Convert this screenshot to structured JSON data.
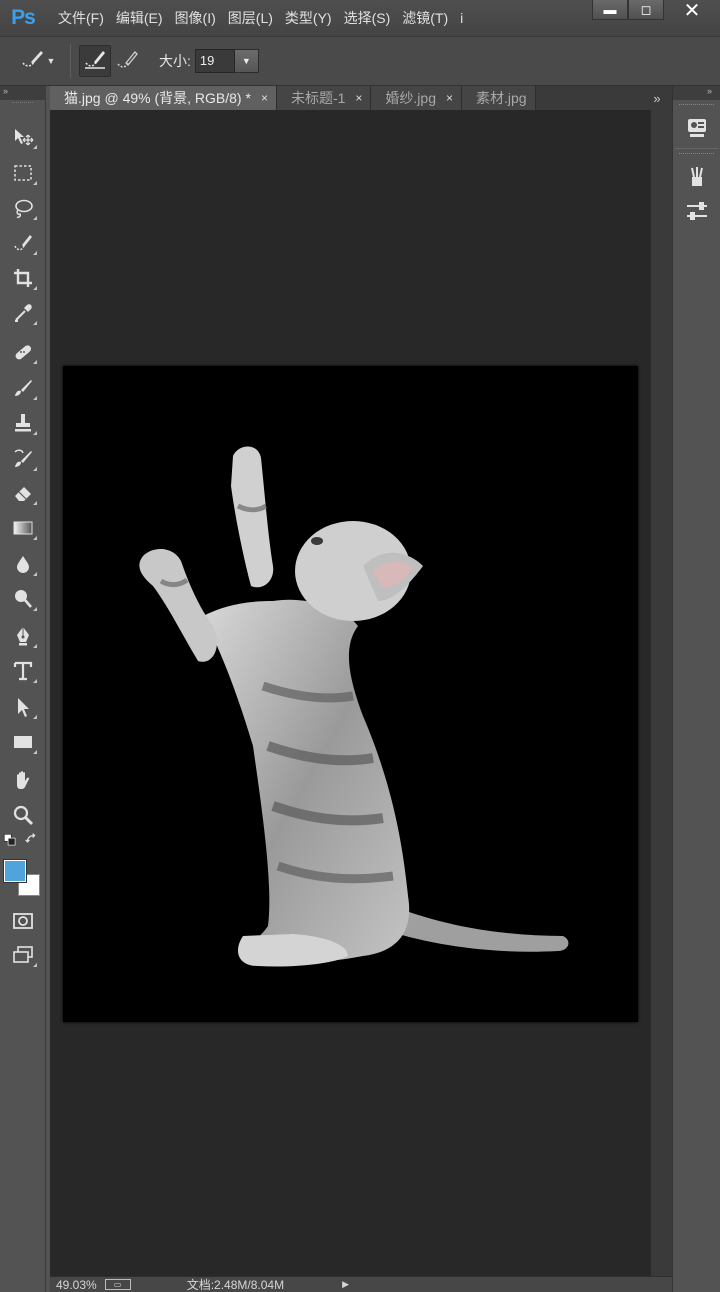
{
  "app": {
    "logo": "Ps"
  },
  "menu": {
    "items": [
      "文件(F)",
      "编辑(E)",
      "图像(I)",
      "图层(L)",
      "类型(Y)",
      "选择(S)",
      "滤镜(T)",
      "i"
    ]
  },
  "window_controls": {
    "minimize": "▬",
    "restore": "◻",
    "close": "✕"
  },
  "options": {
    "size_label": "大小:",
    "size_value": "19",
    "tool_icon": "quick-selection-icon",
    "mode_icons": [
      "new-selection-brush-icon",
      "subtract-brush-icon"
    ]
  },
  "tabs": [
    {
      "label": "猫.jpg @ 49% (背景, RGB/8) *",
      "active": true
    },
    {
      "label": "未标题-1",
      "active": false
    },
    {
      "label": "婚纱.jpg",
      "active": false
    },
    {
      "label": "素材.jpg",
      "active": false
    }
  ],
  "tab_close_glyph": "×",
  "tab_more_glyph": "»",
  "panel_collapse_glyph": "»",
  "tools": [
    "move-icon",
    "marquee-icon",
    "lasso-icon",
    "quick-selection-icon",
    "crop-icon",
    "eyedropper-icon",
    "healing-brush-icon",
    "brush-icon",
    "clone-stamp-icon",
    "history-brush-icon",
    "eraser-icon",
    "gradient-icon",
    "blur-icon",
    "dodge-icon",
    "pen-icon",
    "type-icon",
    "path-selection-icon",
    "rectangle-icon",
    "hand-icon",
    "zoom-icon",
    "quick-mask-icon",
    "screen-mode-icon"
  ],
  "colors": {
    "foreground": "#4fa4dc",
    "background": "#ffffff",
    "canvas_bg": "#282828",
    "document": "#000000"
  },
  "status": {
    "zoom": "49.03%",
    "doc_info": "文档:2.48M/8.04M",
    "arrow": "▶"
  },
  "right_panel": {
    "buttons": [
      "history-icon",
      "brush-preset-icon",
      "adjustments-icon"
    ]
  }
}
